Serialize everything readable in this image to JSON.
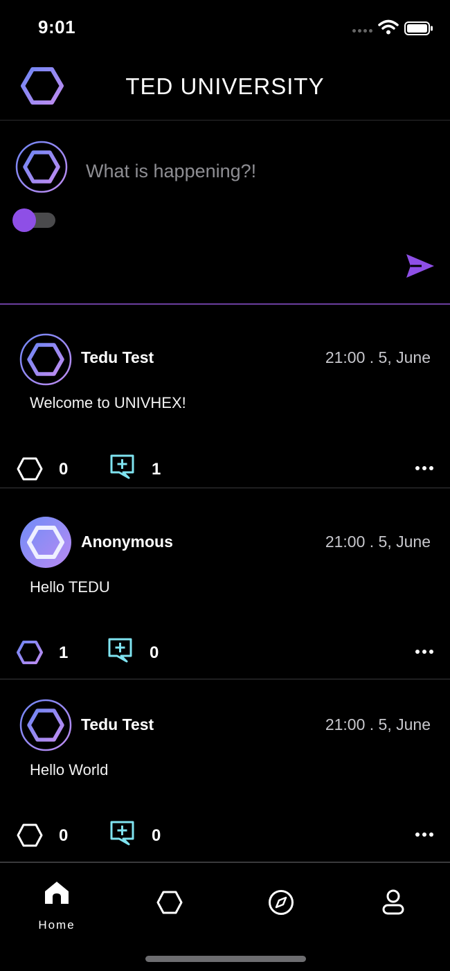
{
  "status_bar": {
    "time": "9:01"
  },
  "header": {
    "title": "TED UNIVERSITY"
  },
  "composer": {
    "placeholder": "What is happening?!"
  },
  "posts": [
    {
      "author": "Tedu Test",
      "time": "21:00 . 5, June",
      "body": "Welcome to UNIVHEX!",
      "likes": "0",
      "comments": "1"
    },
    {
      "author": "Anonymous",
      "time": "21:00 . 5, June",
      "body": "Hello TEDU",
      "likes": "1",
      "comments": "0"
    },
    {
      "author": "Tedu Test",
      "time": "21:00 . 5, June",
      "body": "Hello World",
      "likes": "0",
      "comments": "0"
    }
  ],
  "tab_bar": {
    "home_label": "Home"
  },
  "colors": {
    "accent": "#8e4fe6",
    "comment": "#7fe3f0",
    "hex_gradient_start": "#7b8cf5",
    "hex_gradient_end": "#b98bf0"
  }
}
